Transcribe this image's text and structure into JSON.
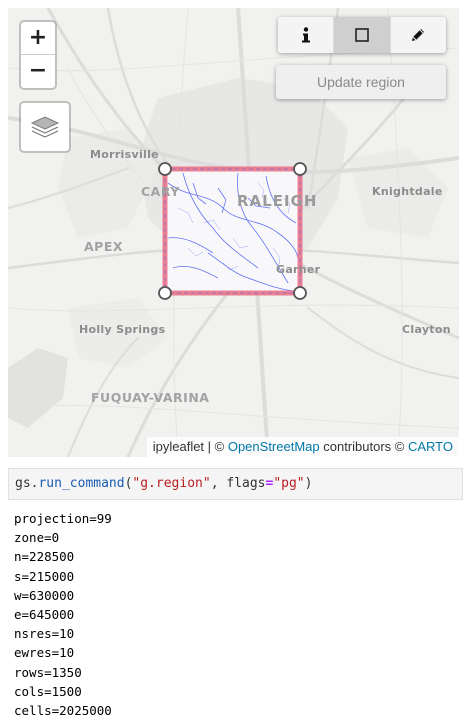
{
  "map": {
    "zoom_in_label": "+",
    "zoom_out_label": "−",
    "layers_icon": "layers-icon",
    "toolbar": {
      "info_icon": "info-icon",
      "rectangle_icon": "rectangle-icon",
      "edit_icon": "pencil-icon",
      "active": "rectangle"
    },
    "update_region_label": "Update region",
    "places": {
      "morrisville": "Morrisville",
      "cary": "CARY",
      "raleigh": "RALEIGH",
      "knightdale": "Knightdale",
      "apex": "APEX",
      "garner": "Garner",
      "holly_springs": "Holly Springs",
      "clayton": "Clayton",
      "fuquay": "FUQUAY-VARINA"
    },
    "attribution": {
      "lib": "ipyleaflet",
      "sep": " | © ",
      "osm": "OpenStreetMap",
      "contrib": " contributors © ",
      "carto": "CARTO"
    },
    "colors": {
      "region_stroke": "#e8627a",
      "region_dash": "#7c6fc4",
      "water": "#4a5cf0",
      "background": "#f1f1ef"
    }
  },
  "notebook": {
    "code": {
      "obj": "gs",
      "dot": ".",
      "func": "run_command",
      "open": "(",
      "arg1": "\"g.region\"",
      "comma": ", flags",
      "eq": "=",
      "arg2": "\"pg\"",
      "close": ")"
    },
    "output_lines": [
      "projection=99",
      "zone=0",
      "n=228500",
      "s=215000",
      "w=630000",
      "e=645000",
      "nsres=10",
      "ewres=10",
      "rows=1350",
      "cols=1500",
      "cells=2025000"
    ]
  }
}
